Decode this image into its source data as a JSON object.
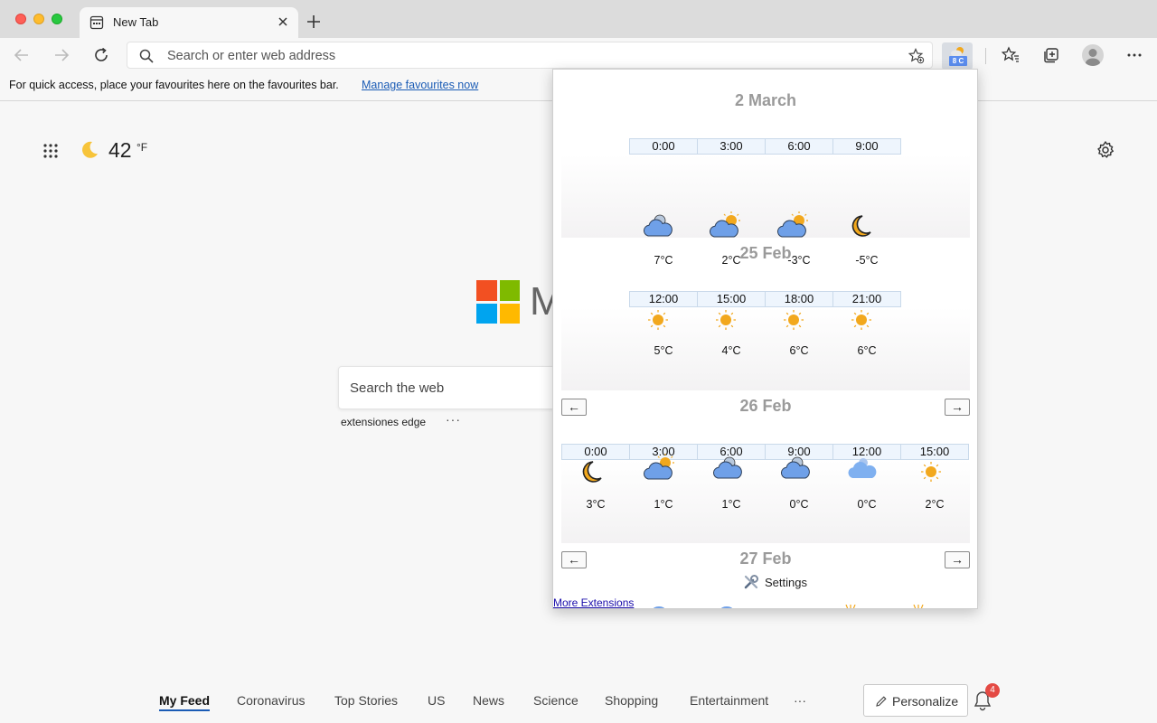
{
  "browser": {
    "tab_title": "New Tab",
    "address_placeholder": "Search or enter web address",
    "extension_badge": "8 C"
  },
  "favourites_bar": {
    "message": "For quick access, place your favourites here on the favourites bar.",
    "link": "Manage favourites now"
  },
  "ntp": {
    "temperature": "42",
    "temperature_unit": "°F",
    "search_placeholder": "Search the web",
    "quick_link": "extensiones edge",
    "quick_link_more": "···",
    "logo_partial_text": "M",
    "feed": [
      {
        "label": "My Feed",
        "active": true
      },
      {
        "label": "Coronavirus"
      },
      {
        "label": "Top Stories"
      },
      {
        "label": "US"
      },
      {
        "label": "News"
      },
      {
        "label": "Science"
      },
      {
        "label": "Shopping"
      },
      {
        "label": "Entertainment"
      },
      {
        "label": "···"
      }
    ],
    "personalize": "Personalize",
    "notification_count": "4"
  },
  "weather_popup": {
    "days": [
      {
        "title": "2 March",
        "slots": [
          {
            "time": "0:00",
            "icon": "cloud-icon",
            "temp": "7°C"
          },
          {
            "time": "3:00",
            "icon": "cloud-sun-icon",
            "temp": "2°C"
          },
          {
            "time": "6:00",
            "icon": "cloud-sun-icon",
            "temp": "-3°C"
          },
          {
            "time": "9:00",
            "icon": "moon-icon",
            "temp": "-5°C"
          }
        ]
      },
      {
        "title": "25 Feb",
        "slots": [
          {
            "time": "12:00",
            "icon": "sun-icon",
            "temp": "5°C"
          },
          {
            "time": "15:00",
            "icon": "sun-icon",
            "temp": "4°C"
          },
          {
            "time": "18:00",
            "icon": "sun-icon",
            "temp": "6°C"
          },
          {
            "time": "21:00",
            "icon": "sun-icon",
            "temp": "6°C"
          }
        ]
      },
      {
        "title": "26 Feb",
        "prev": "←",
        "next": "→",
        "slots": [
          {
            "time": "0:00",
            "icon": "moon-icon",
            "temp": "3°C"
          },
          {
            "time": "3:00",
            "icon": "cloud-sun-icon",
            "temp": "1°C"
          },
          {
            "time": "6:00",
            "icon": "cloud-icon",
            "temp": "1°C"
          },
          {
            "time": "9:00",
            "icon": "cloud-icon",
            "temp": "0°C"
          },
          {
            "time": "12:00",
            "icon": "light-cloud-icon",
            "temp": "0°C"
          },
          {
            "time": "15:00",
            "icon": "sun-icon",
            "temp": "2°C"
          }
        ]
      },
      {
        "title": "27 Feb",
        "prev": "←",
        "next": "→",
        "slots": []
      }
    ],
    "settings_label": "Settings",
    "more_extensions": "More Extensions"
  },
  "colors": {
    "accent": "#1a5bb5",
    "cloud": "#6fa0e8",
    "sun": "#f2a81d",
    "ms_red": "#f25022",
    "ms_green": "#7fba00",
    "ms_blue": "#00a4ef",
    "ms_yellow": "#ffb900"
  }
}
